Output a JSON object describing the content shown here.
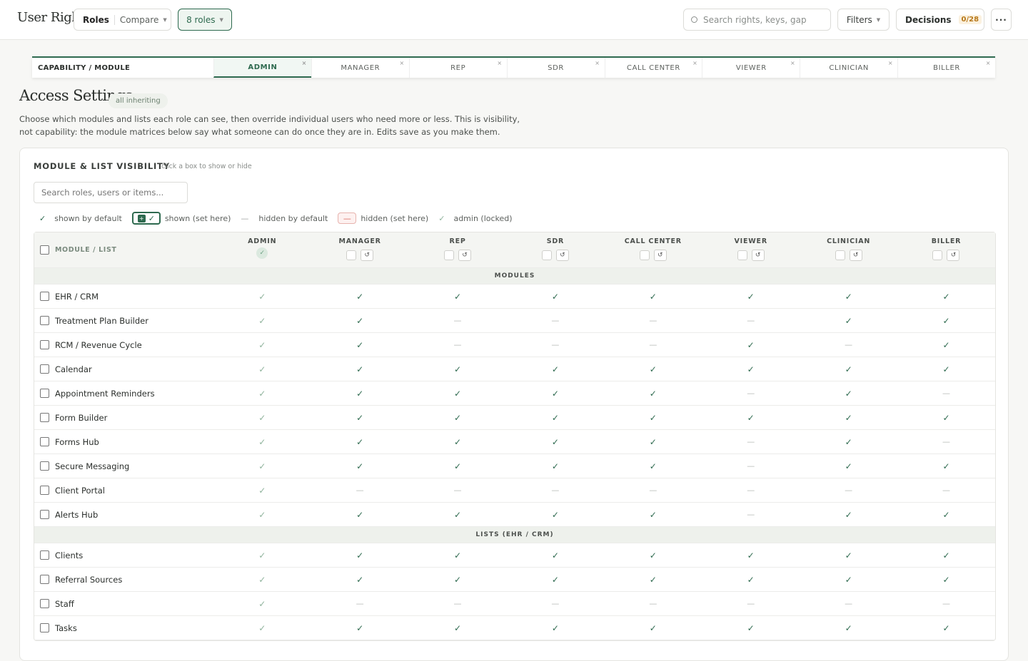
{
  "app": {
    "title": "User Rights"
  },
  "topbar": {
    "seg_roles": "Roles",
    "seg_compare": "Compare",
    "roles_count": "8 roles",
    "search_placeholder": "Search rights, keys, gap",
    "filters": "Filters",
    "decisions": "Decisions",
    "decisions_count": "0/28",
    "more": "···"
  },
  "capstrip": {
    "first": "CAPABILITY / MODULE",
    "tabs": [
      "ADMIN",
      "MANAGER",
      "REP",
      "SDR",
      "CALL CENTER",
      "VIEWER",
      "CLINICIAN",
      "BILLER"
    ],
    "close": "×"
  },
  "page": {
    "title": "Access Settings",
    "badge": "all inheriting",
    "intro": "Choose which modules and lists each role can see, then override individual users who need more or less. This is visibility, not capability: the module matrices below say what someone can do once they are in. Edits save as you make them."
  },
  "card": {
    "title": "MODULE & LIST VISIBILITY",
    "hint": "click a box to show or hide",
    "search_placeholder": "Search roles, users or items..."
  },
  "legend": {
    "shown_default": "shown by default",
    "shown_set": "shown (set here)",
    "hidden_default": "hidden by default",
    "hidden_set": "hidden (set here)",
    "admin_locked": "admin (locked)"
  },
  "matrix": {
    "corner": "MODULE / LIST",
    "roles": [
      "ADMIN",
      "MANAGER",
      "REP",
      "SDR",
      "CALL CENTER",
      "VIEWER",
      "CLINICIAN",
      "BILLER"
    ],
    "reset_glyph": "↺",
    "sections": [
      {
        "title": "MODULES",
        "rows": [
          {
            "name": "EHR / CRM",
            "v": [
              1,
              1,
              1,
              1,
              1,
              1,
              1,
              1
            ]
          },
          {
            "name": "Treatment Plan Builder",
            "v": [
              1,
              1,
              0,
              0,
              0,
              0,
              1,
              1
            ]
          },
          {
            "name": "RCM / Revenue Cycle",
            "v": [
              1,
              1,
              0,
              0,
              0,
              1,
              0,
              1
            ]
          },
          {
            "name": "Calendar",
            "v": [
              1,
              1,
              1,
              1,
              1,
              1,
              1,
              1
            ]
          },
          {
            "name": "Appointment Reminders",
            "v": [
              1,
              1,
              1,
              1,
              1,
              0,
              1,
              0
            ]
          },
          {
            "name": "Form Builder",
            "v": [
              1,
              1,
              1,
              1,
              1,
              1,
              1,
              1
            ]
          },
          {
            "name": "Forms Hub",
            "v": [
              1,
              1,
              1,
              1,
              1,
              0,
              1,
              0
            ]
          },
          {
            "name": "Secure Messaging",
            "v": [
              1,
              1,
              1,
              1,
              1,
              0,
              1,
              1
            ]
          },
          {
            "name": "Client Portal",
            "v": [
              1,
              0,
              0,
              0,
              0,
              0,
              0,
              0
            ]
          },
          {
            "name": "Alerts Hub",
            "v": [
              1,
              1,
              1,
              1,
              1,
              0,
              1,
              1
            ]
          }
        ]
      },
      {
        "title": "LISTS (EHR / CRM)",
        "rows": [
          {
            "name": "Clients",
            "v": [
              1,
              1,
              1,
              1,
              1,
              1,
              1,
              1
            ]
          },
          {
            "name": "Referral Sources",
            "v": [
              1,
              1,
              1,
              1,
              1,
              1,
              1,
              1
            ]
          },
          {
            "name": "Staff",
            "v": [
              1,
              0,
              0,
              0,
              0,
              0,
              0,
              0
            ]
          },
          {
            "name": "Tasks",
            "v": [
              1,
              1,
              1,
              1,
              1,
              1,
              1,
              1
            ]
          }
        ]
      }
    ]
  },
  "glyphs": {
    "check": "✓",
    "dash": "—"
  },
  "colors": {
    "accent": "#2e6a4f",
    "admin_check": "#8fb39c",
    "hidden": "#d9675c",
    "badge": "#b7781a"
  }
}
